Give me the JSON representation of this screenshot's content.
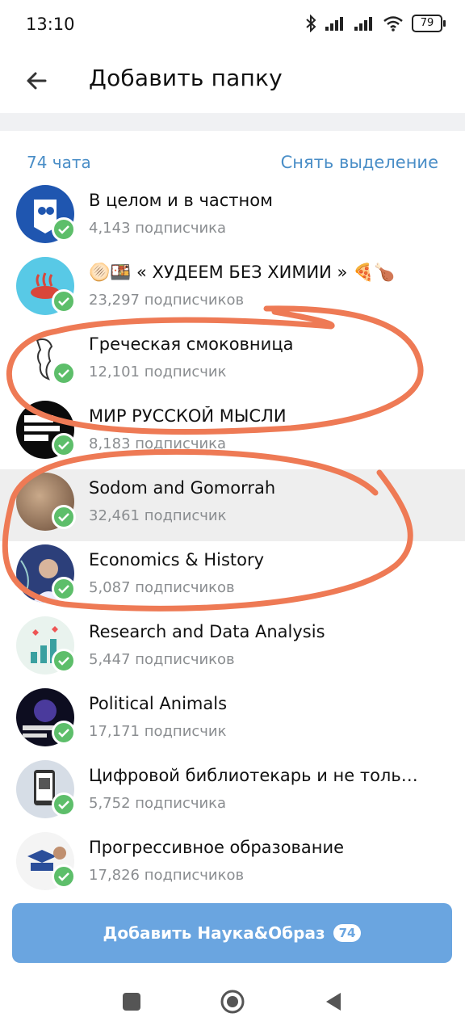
{
  "status_bar": {
    "time": "13:10",
    "battery": "79"
  },
  "header": {
    "title": "Добавить папку"
  },
  "section": {
    "count": "74 чата",
    "deselect": "Снять выделение"
  },
  "channels": [
    {
      "name": "В целом и в частном",
      "subscribers": "4,143 подписчика",
      "highlighted": false
    },
    {
      "name": "🫓🍱 « ХУДЕЕМ БЕЗ ХИМИИ » 🍕🍗",
      "subscribers": "23,297 подписчиков",
      "highlighted": false
    },
    {
      "name": "Греческая смоковница",
      "subscribers": "12,101 подписчик",
      "highlighted": false
    },
    {
      "name": "МИР РУССКОЙ МЫСЛИ",
      "subscribers": "8,183 подписчика",
      "highlighted": false
    },
    {
      "name": "Sodom and Gomorrah",
      "subscribers": "32,461 подписчик",
      "highlighted": true
    },
    {
      "name": "Economics & History",
      "subscribers": "5,087 подписчиков",
      "highlighted": false
    },
    {
      "name": "Research and Data Analysis",
      "subscribers": "5,447 подписчиков",
      "highlighted": false
    },
    {
      "name": "Political Animals",
      "subscribers": "17,171 подписчик",
      "highlighted": false
    },
    {
      "name": "Цифровой библиотекарь и не толь…",
      "subscribers": "5,752 подписчика",
      "highlighted": false
    },
    {
      "name": "Прогрессивное образование",
      "subscribers": "17,826 подписчиков",
      "highlighted": false
    }
  ],
  "action_button": {
    "label": "Добавить Наука&Образ",
    "badge": "74"
  },
  "colors": {
    "accent": "#4a8ec7",
    "button": "#6aa5e0",
    "check": "#5dbe6a",
    "annotation": "#ee7a55"
  }
}
